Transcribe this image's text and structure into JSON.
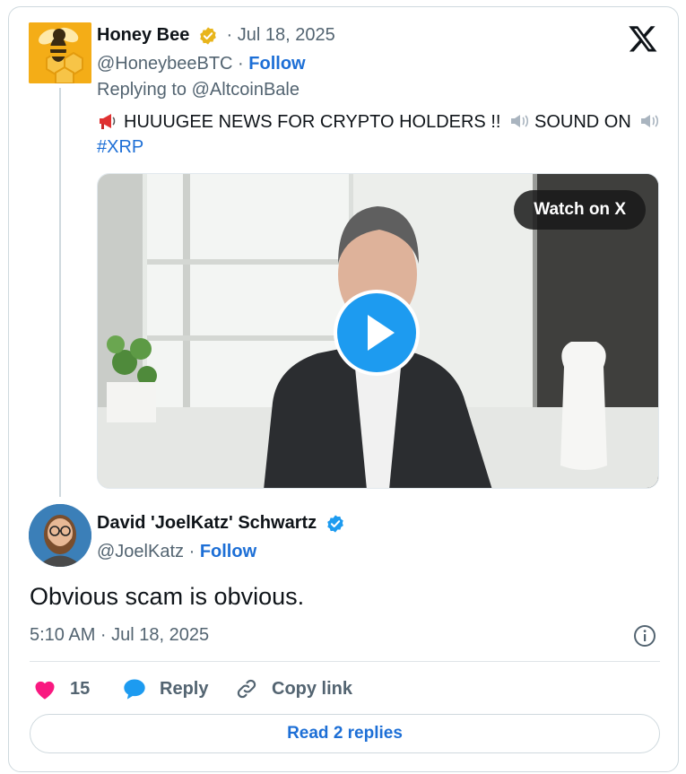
{
  "original_tweet": {
    "display_name": "Honey Bee",
    "separator": "·",
    "date": "Jul 18, 2025",
    "handle": "@HoneybeeBTC",
    "follow_label": "Follow",
    "replying_to": "Replying to @AltcoinBale",
    "text": "HUUUGEE NEWS FOR CRYPTO HOLDERS !!",
    "text_sound": "SOUND ON",
    "hashtag": "#XRP",
    "verified_badge_icon": "gold-verified-badge-icon",
    "media": {
      "watch_label": "Watch on X",
      "play_icon": "play-icon"
    }
  },
  "reply_tweet": {
    "display_name": "David 'JoelKatz' Schwartz",
    "handle": "@JoelKatz",
    "follow_label": "Follow",
    "verified_badge_icon": "blue-verified-badge-icon",
    "text": "Obvious scam is obvious.",
    "timestamp": "5:10 AM · Jul 18, 2025"
  },
  "actions": {
    "like_count": "15",
    "reply_label": "Reply",
    "copy_link_label": "Copy link"
  },
  "read_replies_label": "Read 2 replies",
  "colors": {
    "link_blue": "#1d6fd6",
    "verified_blue": "#1d9bf0",
    "verified_gold": "#e8b51c",
    "like_pink": "#f91880",
    "muted_gray": "#536471"
  }
}
